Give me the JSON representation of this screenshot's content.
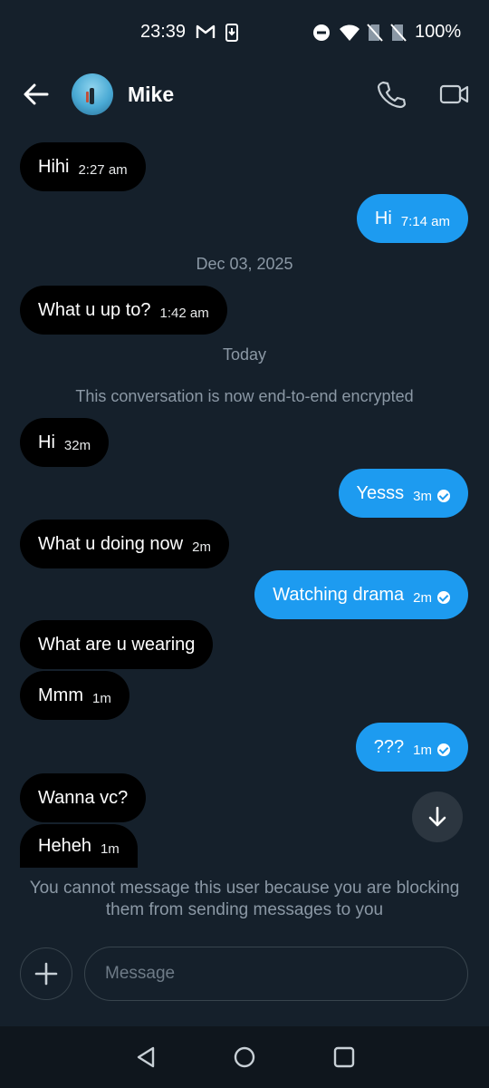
{
  "status_bar": {
    "time": "23:39",
    "battery": "100%",
    "icons": [
      "gmail-icon",
      "download-icon",
      "dnd-icon",
      "wifi-icon",
      "no-sim-icon",
      "no-sim-icon",
      "battery-icon"
    ]
  },
  "header": {
    "contact_name": "Mike",
    "icons": [
      "back-arrow-icon",
      "phone-icon",
      "video-camera-icon"
    ]
  },
  "messages": [
    {
      "dir": "in",
      "text": "Hihi",
      "time": "2:27 am"
    },
    {
      "dir": "out",
      "text": "Hi",
      "time": "7:14 am"
    },
    {
      "dir": "in",
      "text": "What u up to?",
      "time": "1:42 am"
    },
    {
      "dir": "in",
      "text": "Hi",
      "time": "32m"
    },
    {
      "dir": "out",
      "text": "Yesss",
      "time": "3m",
      "read": true
    },
    {
      "dir": "in",
      "text": "What u doing now",
      "time": "2m"
    },
    {
      "dir": "out",
      "text": "Watching drama",
      "time": "2m",
      "read": true
    },
    {
      "dir": "in",
      "text": "What are u wearing",
      "time": ""
    },
    {
      "dir": "in",
      "text": "Mmm",
      "time": "1m"
    },
    {
      "dir": "out",
      "text": "???",
      "time": "1m",
      "read": true
    },
    {
      "dir": "in",
      "text": "Wanna vc?",
      "time": ""
    },
    {
      "dir": "in",
      "text": "Heheh",
      "time": "1m"
    }
  ],
  "separators": {
    "date1": "Dec 03, 2025",
    "date2": "Today",
    "encryption_notice": "This conversation is now end-to-end encrypted"
  },
  "blocked_notice": "You cannot message this user because you are blocking them from sending messages to you",
  "composer": {
    "placeholder": "Message"
  },
  "colors": {
    "background": "#15202b",
    "incoming_bubble": "#000000",
    "outgoing_bubble": "#1d9bf0",
    "muted_text": "#8b98a5"
  }
}
